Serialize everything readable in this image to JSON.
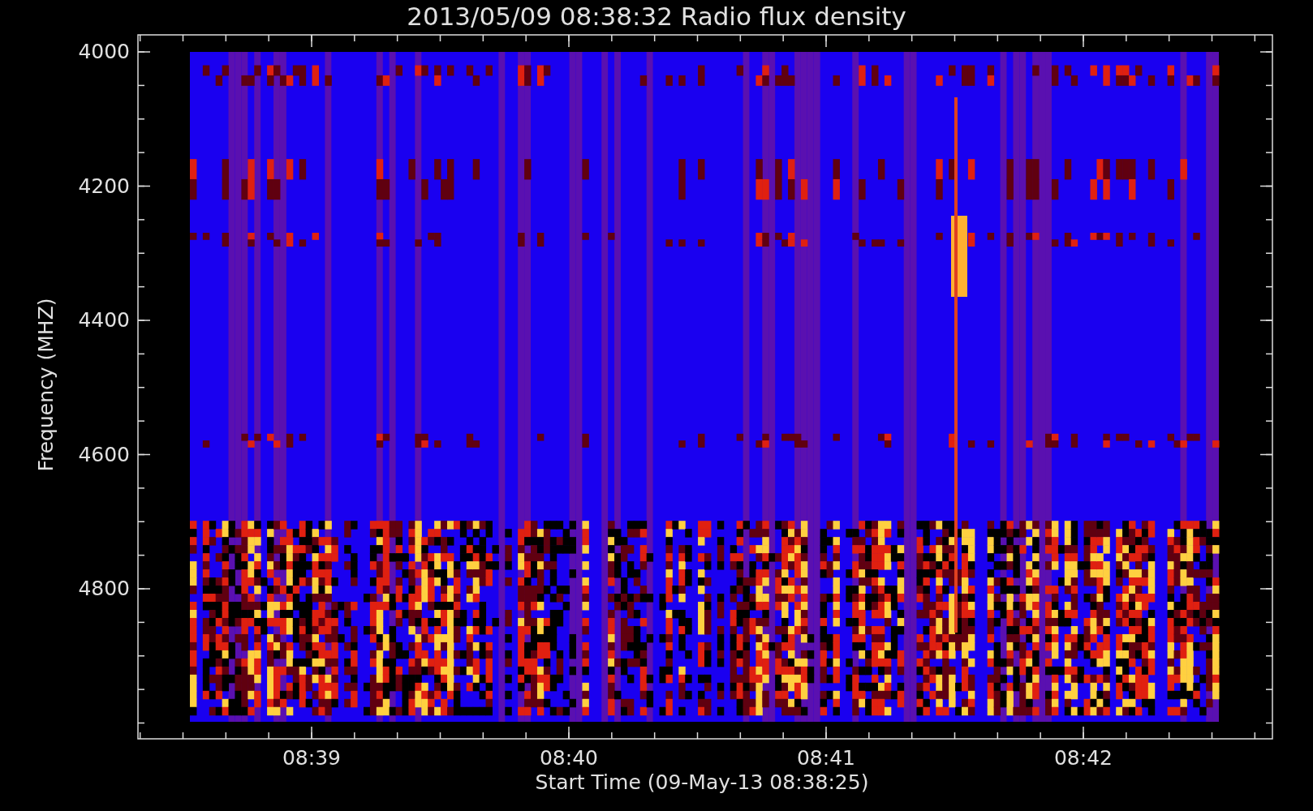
{
  "title": "2013/05/09 08:38:32 Radio flux density",
  "y_axis": {
    "label": "Frequency (MHZ)",
    "ticks": [
      "4000",
      "4200",
      "4400",
      "4600",
      "4800"
    ]
  },
  "x_axis": {
    "label": "Start Time (09-May-13 08:38:25)",
    "ticks": [
      "08:39",
      "08:40",
      "08:41",
      "08:42"
    ]
  }
}
